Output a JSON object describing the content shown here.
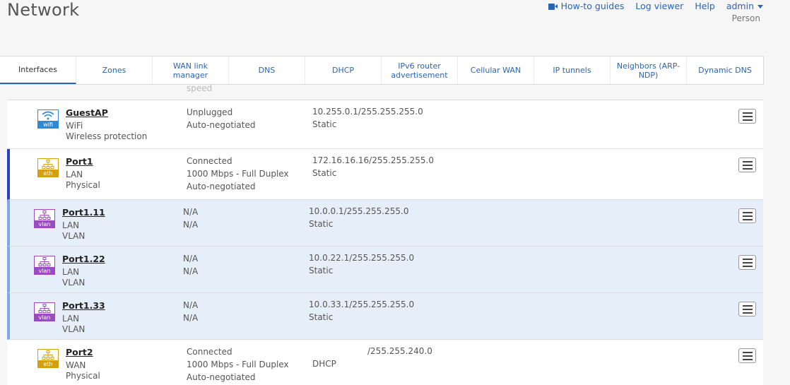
{
  "header": {
    "title": "Network",
    "nav": {
      "howto": "How-to guides",
      "logviewer": "Log viewer",
      "help": "Help",
      "user": "admin",
      "role": "Person"
    }
  },
  "tabs": [
    {
      "label": "Interfaces"
    },
    {
      "label": "Zones"
    },
    {
      "label": "WAN link manager"
    },
    {
      "label": "DNS"
    },
    {
      "label": "DHCP"
    },
    {
      "label": "IPv6 router advertisement"
    },
    {
      "label": "Cellular WAN"
    },
    {
      "label": "IP tunnels"
    },
    {
      "label": "Neighbors (ARP-NDP)"
    },
    {
      "label": "Dynamic DNS"
    }
  ],
  "ghost_text": "speed",
  "rows": [
    {
      "icon": "wifi",
      "tag": "wifi",
      "name": "GuestAP",
      "zone": "WiFi",
      "kind": "Wireless protection",
      "s1": "Unplugged",
      "s2": "Auto-negotiated",
      "s3": "",
      "ip": "10.255.0.1/255.255.255.0",
      "mode": "Static"
    },
    {
      "icon": "eth",
      "tag": "eth",
      "name": "Port1",
      "zone": "LAN",
      "kind": "Physical",
      "s1": "Connected",
      "s2": "1000 Mbps - Full Duplex",
      "s3": "Auto-negotiated",
      "ip": "172.16.16.16/255.255.255.0",
      "mode": "Static"
    },
    {
      "icon": "vlan",
      "tag": "vlan",
      "name": "Port1.11",
      "zone": "LAN",
      "kind": "VLAN",
      "s1": "N/A",
      "s2": "N/A",
      "s3": "",
      "ip": "10.0.0.1/255.255.255.0",
      "mode": "Static"
    },
    {
      "icon": "vlan",
      "tag": "vlan",
      "name": "Port1.22",
      "zone": "LAN",
      "kind": "VLAN",
      "s1": "N/A",
      "s2": "N/A",
      "s3": "",
      "ip": "10.0.22.1/255.255.255.0",
      "mode": "Static"
    },
    {
      "icon": "vlan",
      "tag": "vlan",
      "name": "Port1.33",
      "zone": "LAN",
      "kind": "VLAN",
      "s1": "N/A",
      "s2": "N/A",
      "s3": "",
      "ip": "10.0.33.1/255.255.255.0",
      "mode": "Static"
    },
    {
      "icon": "eth",
      "tag": "eth",
      "name": "Port2",
      "zone": "WAN",
      "kind": "Physical",
      "s1": "Connected",
      "s2": "1000 Mbps - Full Duplex",
      "s3": "Auto-negotiated",
      "ip": "/255.255.240.0",
      "mode": "DHCP"
    }
  ]
}
